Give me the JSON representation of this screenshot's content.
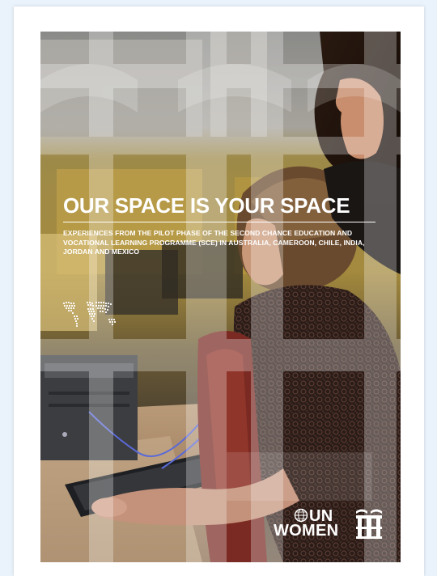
{
  "cover": {
    "title": "OUR SPACE IS YOUR SPACE",
    "subtitle": "EXPERIENCES FROM THE PILOT PHASE OF THE SECOND CHANCE EDUCATION AND VOCATIONAL LEARNING PROGRAMME (SCE) IN AUSTRALIA, CAMEROON, CHILE, INDIA, JORDAN AND MEXICO",
    "logo": {
      "line1": "UN",
      "line2": "WOMEN",
      "globe_icon": "un-globe-icon",
      "emblem_icon": "un-women-emblem-icon"
    },
    "map_icon": "dotted-world-map-icon",
    "colors": {
      "page_background": "#eaf2fb",
      "paper": "#ffffff",
      "title_text": "#ffffff",
      "photo_warm": "#b59a4a",
      "photo_dark": "#2b2a26"
    }
  }
}
